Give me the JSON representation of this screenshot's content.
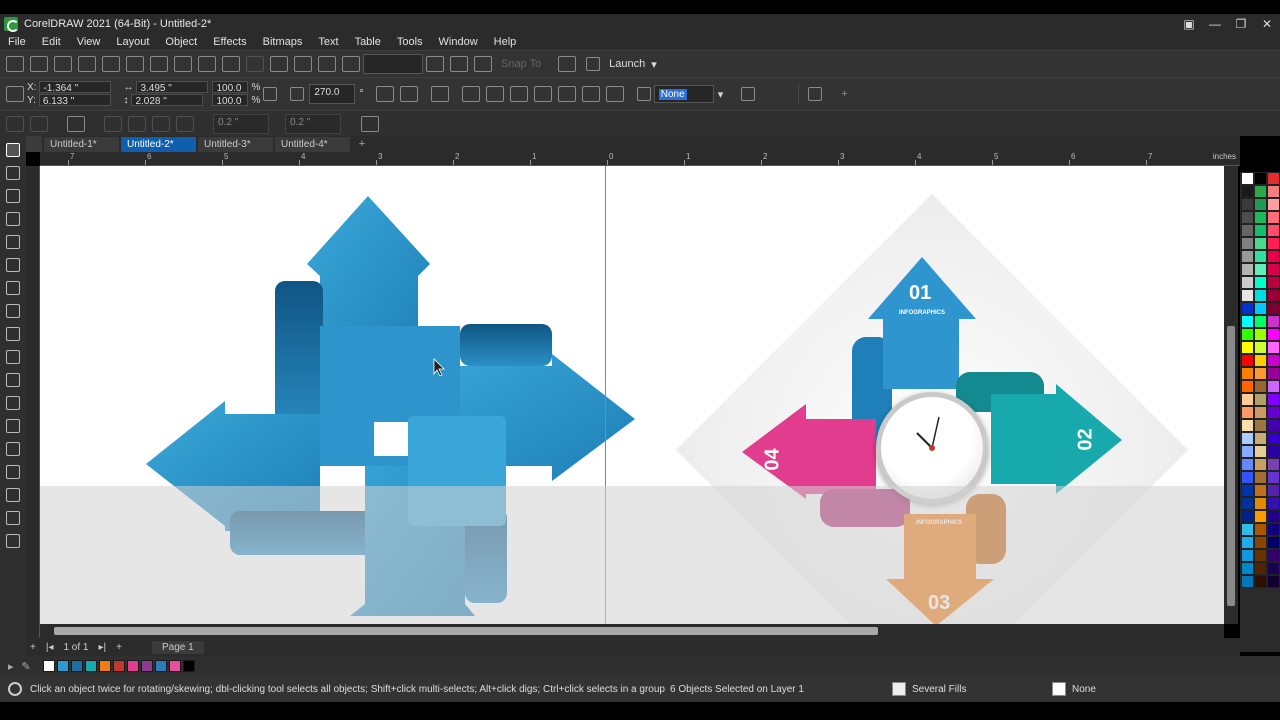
{
  "window": {
    "title": "CorelDRAW 2021 (64-Bit) - Untitled-2*"
  },
  "menu": [
    "File",
    "Edit",
    "View",
    "Layout",
    "Object",
    "Effects",
    "Bitmaps",
    "Text",
    "Table",
    "Tools",
    "Window",
    "Help"
  ],
  "toolbar": {
    "launch_label": "Launch",
    "snap_to_label": "Snap To"
  },
  "property_bar": {
    "x": "-1.364 \"",
    "y": "6.133 \"",
    "width": "3.495 \"",
    "height": "2.028 \"",
    "scale_w": "100.0",
    "scale_h": "100.0",
    "percent": "%",
    "rotation": "270.0",
    "rotation_unit": "°",
    "outline": "None"
  },
  "toolbar3": {
    "outline_w1": "0.2 \"",
    "outline_w2": "0.2 \""
  },
  "tabs": [
    {
      "label": "Untitled-1*",
      "active": false
    },
    {
      "label": "Untitled-2*",
      "active": true
    },
    {
      "label": "Untitled-3*",
      "active": false
    },
    {
      "label": "Untitled-4*",
      "active": false
    }
  ],
  "ruler": {
    "units": "inches",
    "labels": [
      "7",
      "6",
      "5",
      "4",
      "3",
      "2",
      "1",
      "0",
      "1",
      "2",
      "3",
      "4",
      "5",
      "6",
      "7"
    ]
  },
  "infographic": {
    "numbers": [
      "01",
      "02",
      "03",
      "04"
    ],
    "heading": "INFOGRAPHICS"
  },
  "page_nav": {
    "count": "1 of 1",
    "page_tab": "Page 1"
  },
  "status": {
    "hint": "Click an object twice for rotating/skewing; dbl-clicking tool selects all objects; Shift+click multi-selects; Alt+click digs; Ctrl+click selects in a group",
    "selection": "6 Objects Selected on Layer 1",
    "fill": "Several Fills",
    "outline": "None"
  },
  "colors": {
    "accent": "#0f5fae",
    "blue_arrow": "#2f9ad0",
    "magenta": "#e23c8e",
    "teal": "#18a9ad",
    "orange": "#ef7d16"
  },
  "doc_palette": [
    "#ffffff",
    "#2f9ad0",
    "#1b6ea8",
    "#18a9ad",
    "#ef7d16",
    "#c0392b",
    "#e23c8e",
    "#8c3b8f",
    "#2a7dbd",
    "#e84f9a",
    "#000000"
  ],
  "palette": [
    "#ffffff",
    "#000000",
    "#e12d2d",
    "#1a1a1a",
    "#2aa84a",
    "#f08080",
    "#3a3a3a",
    "#229955",
    "#ff9f9f",
    "#4d4d4d",
    "#1fb85c",
    "#ff6f7a",
    "#666666",
    "#13c06a",
    "#ff4d6d",
    "#808080",
    "#4ad98a",
    "#ff1e56",
    "#999999",
    "#31e0a0",
    "#e6004c",
    "#b3b3b3",
    "#5cf0b8",
    "#d4004a",
    "#cccccc",
    "#00ffcc",
    "#b8003e",
    "#e6e6e6",
    "#00e0e0",
    "#99003a",
    "#0033cc",
    "#00c8ff",
    "#7a0033",
    "#00ffff",
    "#00ff66",
    "#cc33cc",
    "#33ff00",
    "#99ff00",
    "#ff00ff",
    "#ffff00",
    "#ccff33",
    "#ff66ff",
    "#ff0000",
    "#ffcc00",
    "#cc00cc",
    "#ff8000",
    "#ff9933",
    "#990099",
    "#ff6600",
    "#996633",
    "#cc66ff",
    "#ffcc99",
    "#b3a16b",
    "#8000ff",
    "#ff9966",
    "#cc9966",
    "#6600cc",
    "#ffddaa",
    "#997744",
    "#4400aa",
    "#aaccff",
    "#ccaa77",
    "#3300cc",
    "#88aaff",
    "#e6cc99",
    "#2a00a0",
    "#6688ff",
    "#c8a060",
    "#7a3fb0",
    "#3355ff",
    "#a07030",
    "#6633cc",
    "#0033aa",
    "#c07020",
    "#5522aa",
    "#003399",
    "#e08a00",
    "#3311aa",
    "#002288",
    "#ff9900",
    "#220088",
    "#33bbee",
    "#aa5500",
    "#110077",
    "#22aaee",
    "#884400",
    "#000066",
    "#1199dd",
    "#663300",
    "#330066",
    "#0088cc",
    "#552200",
    "#1a0055",
    "#0077bb",
    "#2a1100",
    "#120033"
  ]
}
